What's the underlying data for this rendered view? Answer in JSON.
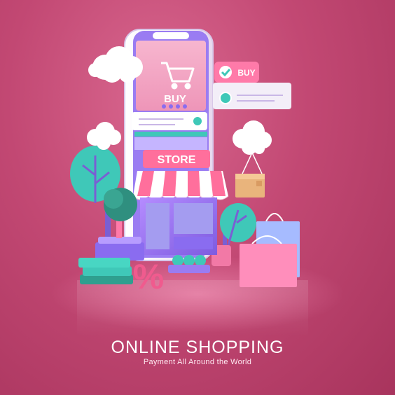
{
  "illustration": {
    "phone_buy_label": "BUY",
    "buy_tag_label": "BUY",
    "store_sign_label": "STORE",
    "percent_symbol": "%",
    "icons": [
      "shopping-cart-icon",
      "checkmark-icon",
      "percent-icon",
      "cardboard-box-icon",
      "shopping-bag-icon",
      "cloud-icon",
      "tree-icon"
    ]
  },
  "caption": {
    "title": "ONLINE SHOPPING",
    "subtitle": "Payment All Around the World"
  },
  "colors": {
    "background": "#c24873",
    "phone_screen": "#f3a6c5",
    "accent_purple": "#8a6cf0",
    "accent_teal": "#3fc8b8",
    "store_sign": "#ff6f9c"
  }
}
